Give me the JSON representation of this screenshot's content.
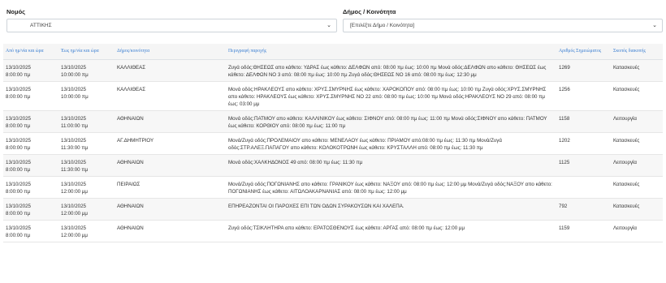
{
  "filters": {
    "prefecture_label": "Νομός",
    "prefecture_value": "ΑΤΤΙΚΗΣ",
    "municipality_label": "Δήμος / Κοινότητα",
    "municipality_placeholder": "[Επιλέξτε Δήμο / Κοινότητα]",
    "chevron_icon": "chevron-down-icon"
  },
  "table": {
    "headers": [
      "Από ημ/νία και ώρα",
      "Έως ημ/νία και ώρα",
      "Δήμος/κοινότητα",
      "Περιγραφή παροχής",
      "Αριθμός Σημειώματος",
      "Σκοπός διακοπής"
    ],
    "rows": [
      {
        "from": [
          "13/10/2025",
          "8:00:00 πμ"
        ],
        "to": [
          "13/10/2025",
          "10:00:00 πμ"
        ],
        "municipality": "ΚΑΛΛΙΘΕΑΣ",
        "description": "Ζυγά οδός:ΘΗΣΕΩΣ απο κάθετο: ΥΔΡΑΣ έως κάθετο: ΔΕΛΦΩΝ από: 08:00 πμ έως: 10:00 πμ Μονά οδός:ΔΕΛΦΩΝ απο κάθετο: ΘΗΣΕΩΣ έως κάθετο: ΔΕΛΦΩΝ ΝΟ 3 από: 08:00 πμ έως: 10:00 πμ Ζυγά οδός:ΘΗΣΕΩΣ ΝΟ 16 από: 08:00 πμ έως: 12:30 μμ",
        "number": "1269",
        "purpose": "Κατασκευές"
      },
      {
        "from": [
          "13/10/2025",
          "8:00:00 πμ"
        ],
        "to": [
          "13/10/2025",
          "10:00:00 πμ"
        ],
        "municipality": "ΚΑΛΛΙΘΕΑΣ",
        "description": "Μονά οδός:ΗΡΑΚΛΕΟΥΣ απο κάθετο: ΧΡΥΣ.ΣΜΥΡΝΗΣ έως κάθετο: ΧΑΡΟΚΟΠΟΥ από: 08:00 πμ έως: 10:00 πμ Ζυγά οδός:ΧΡΥΣ.ΣΜΥΡΝΗΣ απο κάθετο: ΗΡΑΚΛΕΟΥΣ έως κάθετο: ΧΡΥΣ.ΣΜΥΡΝΗΣ ΝΟ 22 από: 08:00 πμ έως: 10:00 πμ Μονά οδός:ΗΡΑΚΛΕΟΥΣ ΝΟ 29 από: 08:00 πμ έως: 03:00 μμ",
        "number": "1256",
        "purpose": "Κατασκευές"
      },
      {
        "from": [
          "13/10/2025",
          "8:00:00 πμ"
        ],
        "to": [
          "13/10/2025",
          "11:00:00 πμ"
        ],
        "municipality": "ΑΘΗΝΑΙΩΝ",
        "description": "Μονά οδός:ΠΑΤΜΟΥ απο κάθετο: ΚΑΛΛΙΝΙΚΟΥ έως κάθετο: ΣΙΦΝΟΥ από: 08:00 πμ έως: 11:00 πμ Μονά οδός:ΣΙΦΝΟΥ απο κάθετο: ΠΑΤΜΟΥ έως κάθετο: ΚΟΡΘΙΟΥ από: 08:00 πμ έως: 11:00 πμ",
        "number": "1158",
        "purpose": "Λειτουργία"
      },
      {
        "from": [
          "13/10/2025",
          "8:00:00 πμ"
        ],
        "to": [
          "13/10/2025",
          "11:30:00 πμ"
        ],
        "municipality": "ΑΓ.ΔΗΜΗΤΡΙΟΥ",
        "description": "Μονά/Ζυγά οδός:ΠΡΟΛΕΜΑΙΟΥ απο κάθετο: ΜΕΝΕΛΑΟΥ έως κάθετο: ΠΡΙΑΜΟΥ από:08:00 πμ έως: 11:30 πμ Μονά/Ζυγά οδός:ΣΤΡ.ΑΛΕΞ.ΠΑΠΑΓΟΥ απο κάθετο: ΚΟΛΟΚΟΤΡΩΝΗ έως κάθετο: ΚΡΥΣΤΑΛΛΗ από: 08:00 πμ έως: 11:30 πμ",
        "number": "1202",
        "purpose": "Κατασκευές"
      },
      {
        "from": [
          "13/10/2025",
          "8:00:00 πμ"
        ],
        "to": [
          "13/10/2025",
          "11:30:00 πμ"
        ],
        "municipality": "ΑΘΗΝΑΙΩΝ",
        "description": "Μονά οδός:ΧΑΛΚΗΔΟΝΟΣ 49 από: 08:00 πμ έως: 11:30 πμ",
        "number": "1125",
        "purpose": "Λειτουργία"
      },
      {
        "from": [
          "13/10/2025",
          "8:00:00 πμ"
        ],
        "to": [
          "13/10/2025",
          "12:00:00 μμ"
        ],
        "municipality": "ΠΕΙΡΑΙΩΣ",
        "description": "Μονά/Ζυγά οδός:ΠΟΓΩΝΙΑΝΗΣ απο κάθετο: ΓΡΑΝΙΚΟΥ έως κάθετο: ΝΑΞΟΥ από: 08:00 πμ έως: 12:00 μμ Μονά/Ζυγά οδός:ΝΑΞΟΥ απο κάθετο: ΠΟΓΩΝΙΑΝΗΣ έως κάθετο: ΑΙΤΩΛΟΑΚΑΡΝΑΝΙΑΣ από: 08:00 πμ έως: 12:00 μμ",
        "number": "",
        "purpose": "Κατασκευές"
      },
      {
        "from": [
          "13/10/2025",
          "8:00:00 πμ"
        ],
        "to": [
          "13/10/2025",
          "12:00:00 μμ"
        ],
        "municipality": "ΑΘΗΝΑΙΩΝ",
        "description": "ΕΠΗΡΕΑΖΟΝΤΑΙ ΟΙ ΠΑΡΟΧΕΣ ΕΠΙ ΤΩΝ ΟΔΩΝ ΣΥΡΑΚΟΥΣΩΝ ΚΑΙ ΧΑΛΕΠΑ.",
        "number": "792",
        "purpose": "Κατασκευές"
      },
      {
        "from": [
          "13/10/2025",
          "8:00:00 πμ"
        ],
        "to": [
          "13/10/2025",
          "12:00:00 μμ"
        ],
        "municipality": "ΑΘΗΝΑΙΩΝ",
        "description": "Ζυγά οδός:ΤΣΙΚΛΗΤΗΡΑ απο κάθετο: ΕΡΑΤΟΣΘΕΝΟΥΣ έως κάθετο: ΑΡΓΑΣ από: 08:00 πμ έως: 12:00 μμ",
        "number": "1159",
        "purpose": "Λειτουργία"
      }
    ]
  }
}
